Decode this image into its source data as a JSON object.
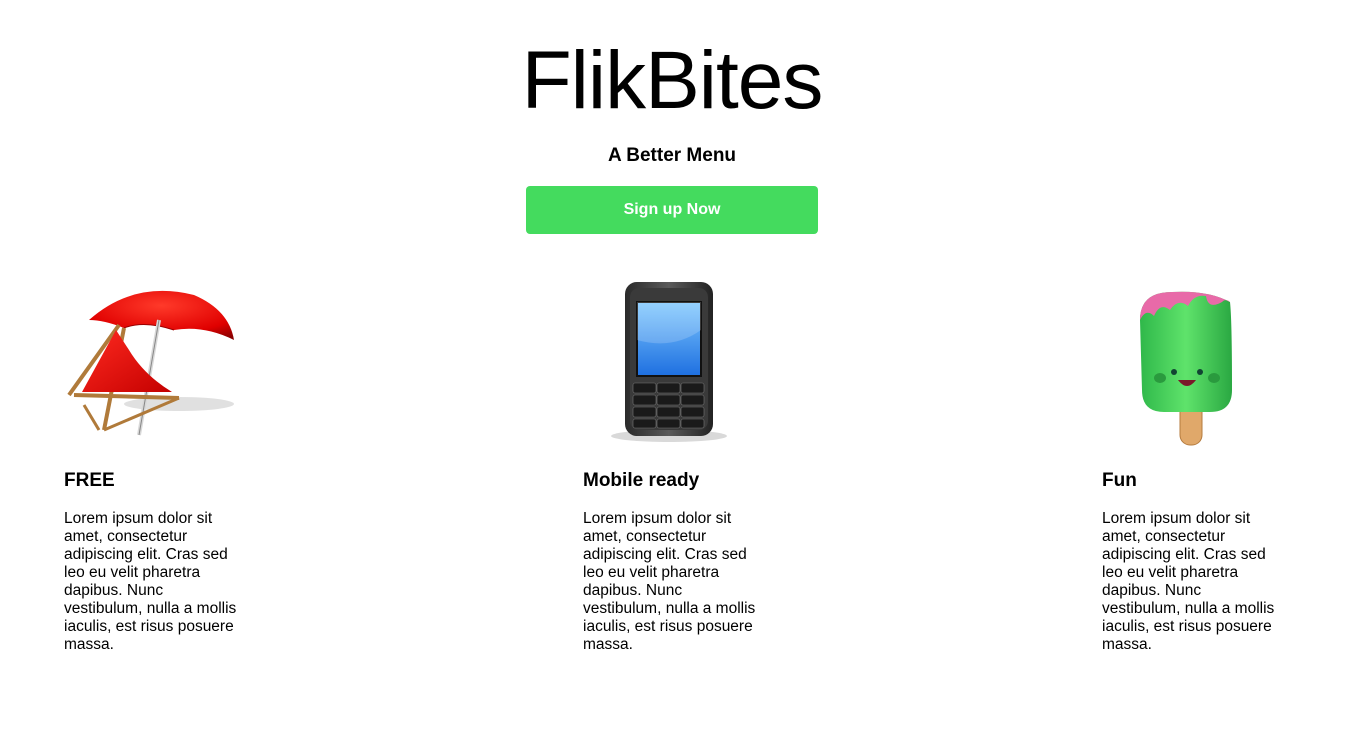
{
  "header": {
    "title": "FlikBites",
    "tagline": "A Better Menu",
    "signup_label": "Sign up Now"
  },
  "colors": {
    "accent": "#44db5e",
    "text": "#000000",
    "background": "#ffffff"
  },
  "features": [
    {
      "icon": "beach-chair-umbrella-icon",
      "heading": "FREE",
      "body": "Lorem ipsum dolor sit amet, consectetur adipiscing elit. Cras sed leo eu velit pharetra dapibus. Nunc vestibulum, nulla a mollis iaculis, est risus posuere massa."
    },
    {
      "icon": "mobile-phone-icon",
      "heading": "Mobile ready",
      "body": "Lorem ipsum dolor sit amet, consectetur adipiscing elit. Cras sed leo eu velit pharetra dapibus. Nunc vestibulum, nulla a mollis iaculis, est risus posuere massa."
    },
    {
      "icon": "popsicle-icon",
      "heading": "Fun",
      "body": "Lorem ipsum dolor sit amet, consectetur adipiscing elit. Cras sed leo eu velit pharetra dapibus. Nunc vestibulum, nulla a mollis iaculis, est risus posuere massa."
    }
  ]
}
